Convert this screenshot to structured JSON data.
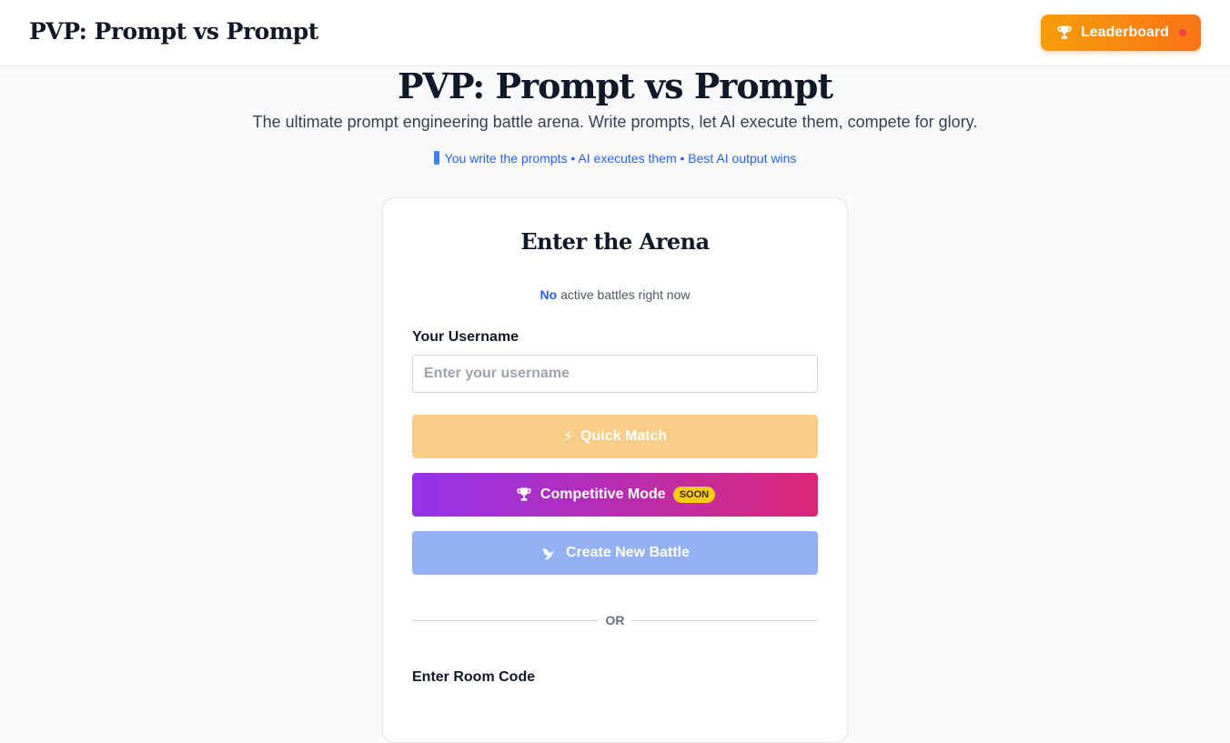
{
  "header": {
    "brand": "PVP: Prompt vs Prompt",
    "leaderboard_label": "Leaderboard"
  },
  "hero": {
    "title": "PVP: Prompt vs Prompt",
    "subtitle": "The ultimate prompt engineering battle arena. Write prompts, let AI execute them, compete for glory.",
    "tagline": "You write the prompts • AI executes them • Best AI output wins"
  },
  "arena": {
    "title": "Enter the Arena",
    "status_count": "No",
    "status_text": "active battles right now",
    "username_label": "Your Username",
    "username_placeholder": "Enter your username",
    "username_value": "",
    "quick_match_label": "Quick Match",
    "competitive_label": "Competitive Mode",
    "competitive_badge": "SOON",
    "create_battle_label": "Create New Battle",
    "divider_text": "OR",
    "room_code_label": "Enter Room Code"
  },
  "icons": {
    "leaderboard": "trophy-icon",
    "quick_match": "lightning-icon",
    "competitive": "trophy-icon",
    "create_battle": "bird-icon"
  },
  "colors": {
    "leaderboard_gradient": [
      "#f59e0b",
      "#f97316"
    ],
    "notification_dot": "#ef4444",
    "quick_match_bg": "#f8cd87",
    "competitive_gradient": [
      "#9333ea",
      "#db2777"
    ],
    "create_battle_bg": "#93b0f2",
    "soon_badge": "#facc15",
    "accent_blue": "#2563eb"
  }
}
